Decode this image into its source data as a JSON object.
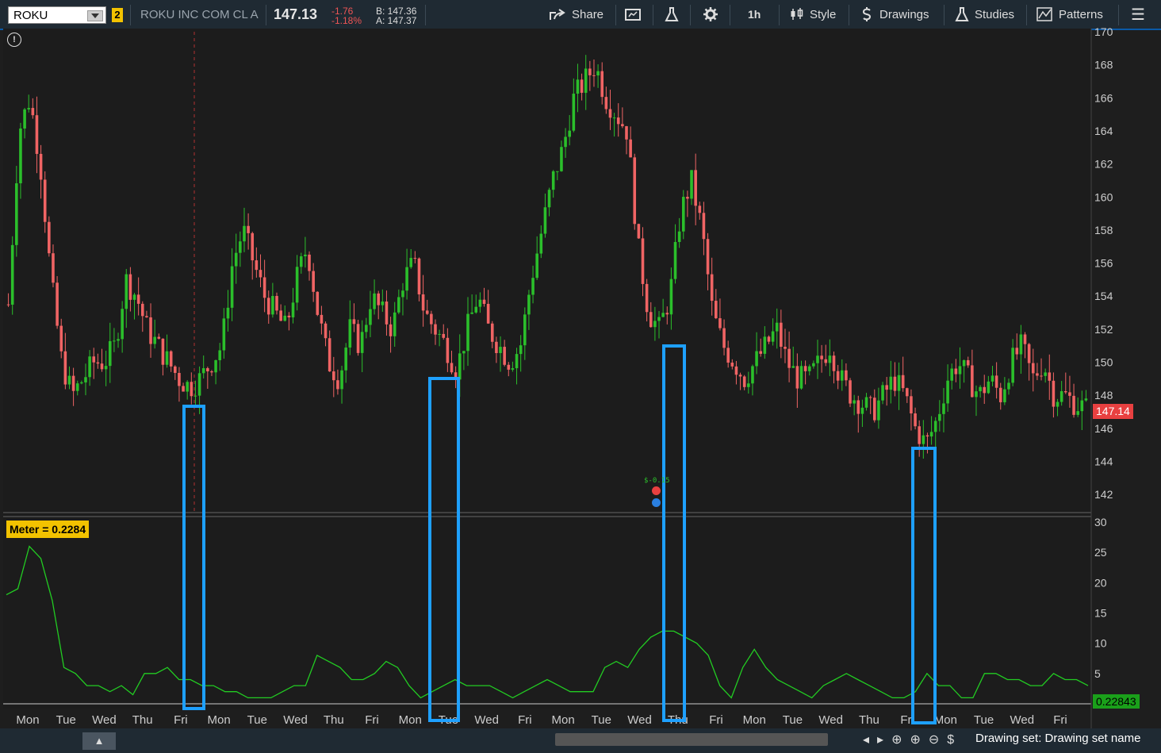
{
  "toolbar": {
    "symbol": "ROKU",
    "link_badge": "2",
    "description": "ROKU INC COM CL A",
    "last_price": "147.13",
    "net_change": "-1.76",
    "pct_change": "-1.18%",
    "bid": "B: 147.36",
    "ask": "A: 147.37",
    "share_label": "Share",
    "timeframe": "1h",
    "style_label": "Style",
    "drawings_label": "Drawings",
    "studies_label": "Studies",
    "patterns_label": "Patterns"
  },
  "study": {
    "meter_label": "Meter = 0.2284",
    "meter_value_box": "0.22843",
    "price_value_box": "147.14",
    "trade_marker": "$-0.15"
  },
  "bottom": {
    "drawing_set": "Drawing set: Drawing set name"
  },
  "colors": {
    "up": "#2bbf2b",
    "down": "#f06464",
    "meter_line": "#22cc22",
    "highlight": "#1ea0ff",
    "toolbar_bg": "#1f2a33"
  },
  "chart_data": [
    {
      "type": "candlestick",
      "title": "",
      "symbol": "ROKU",
      "interval": "1h",
      "ylim": [
        141,
        170
      ],
      "y_ticks": [
        142,
        144,
        146,
        148,
        150,
        152,
        154,
        156,
        158,
        160,
        162,
        164,
        166,
        168,
        170
      ],
      "x_tick_labels": [
        "Mon",
        "Tue",
        "Wed",
        "Thu",
        "Fri",
        "Mon",
        "Tue",
        "Wed",
        "Thu",
        "Fri",
        "Mon",
        "Tue",
        "Wed",
        "Fri",
        "Mon",
        "Tue",
        "Wed",
        "Thu",
        "Fri",
        "Mon",
        "Tue",
        "Wed",
        "Thu",
        "Fri",
        "Mon",
        "Tue",
        "Wed",
        "Fri"
      ],
      "close_path": [
        153.5,
        164,
        166,
        162,
        155,
        150,
        148,
        149,
        150,
        150,
        151,
        155,
        154,
        152,
        151,
        150,
        149,
        148.5,
        149,
        150,
        151,
        156,
        158,
        156,
        154,
        153,
        152,
        155,
        157,
        153,
        150,
        149,
        152,
        151,
        154,
        153,
        152,
        155,
        156,
        153,
        152,
        151,
        149.5,
        152,
        154,
        152,
        151,
        150,
        151,
        155,
        158,
        161,
        163,
        166,
        167,
        168,
        166,
        165,
        164,
        157,
        153,
        152,
        154,
        159,
        161,
        158,
        153,
        151,
        150,
        149,
        150,
        151,
        152,
        150,
        149,
        149,
        150,
        151,
        149,
        148,
        147.5,
        147,
        148,
        149,
        148,
        146,
        145,
        146.5,
        149,
        150,
        149,
        148,
        149,
        148,
        150,
        151,
        149,
        150,
        148,
        148,
        147.5,
        147.2
      ],
      "last_price": 147.14
    },
    {
      "type": "line",
      "title": "",
      "series": [
        {
          "name": "Meter",
          "values": [
            18,
            19,
            26,
            24,
            17,
            6,
            5,
            3,
            3,
            2,
            3,
            1.5,
            5,
            5,
            6,
            4,
            4,
            3,
            3,
            2,
            2,
            1,
            1,
            1,
            2,
            3,
            3,
            8,
            7,
            6,
            4,
            4,
            5,
            7,
            6,
            3,
            1,
            2,
            3,
            4,
            3,
            3,
            3,
            2,
            1,
            2,
            3,
            4,
            3,
            2,
            2,
            2,
            6,
            7,
            6,
            9,
            11,
            12,
            12,
            11,
            10,
            8,
            3,
            1,
            6,
            9,
            6,
            4,
            3,
            2,
            1,
            3,
            4,
            5,
            4,
            3,
            2,
            1,
            1,
            2,
            5,
            3,
            3,
            1,
            1,
            5,
            5,
            4,
            4,
            3,
            3,
            5,
            4,
            4,
            3
          ]
        }
      ],
      "ylim": [
        0,
        30
      ],
      "y_ticks": [
        5,
        10,
        15,
        20,
        25,
        30
      ],
      "last_value": 0.22843
    }
  ]
}
